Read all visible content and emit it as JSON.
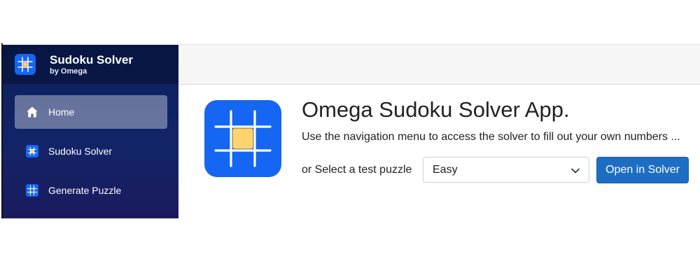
{
  "sidebar": {
    "brand": {
      "title": "Sudoku Solver",
      "subtitle": "by Omega",
      "icon": "sudoku-grid-icon"
    },
    "items": [
      {
        "label": "Home",
        "icon": "home-icon",
        "active": true
      },
      {
        "label": "Sudoku Solver",
        "icon": "sudoku-grid-icon",
        "active": false
      },
      {
        "label": "Generate Puzzle",
        "icon": "grid-generate-icon",
        "active": false
      }
    ]
  },
  "main": {
    "logo_icon": "sudoku-grid-logo",
    "title": "Omega Sudoku Solver App.",
    "description": "Use the navigation menu to access the solver to fill out your own numbers ...",
    "select_label": "or Select a test puzzle",
    "puzzle_select": {
      "value": "Easy"
    },
    "open_button": "Open in Solver"
  },
  "colors": {
    "sidebar_top": "#0b1f5c",
    "sidebar_bottom": "#1c1a5e",
    "accent_blue": "#1566f2",
    "button_blue": "#1b6ec2",
    "logo_center": "#ffd36e"
  }
}
